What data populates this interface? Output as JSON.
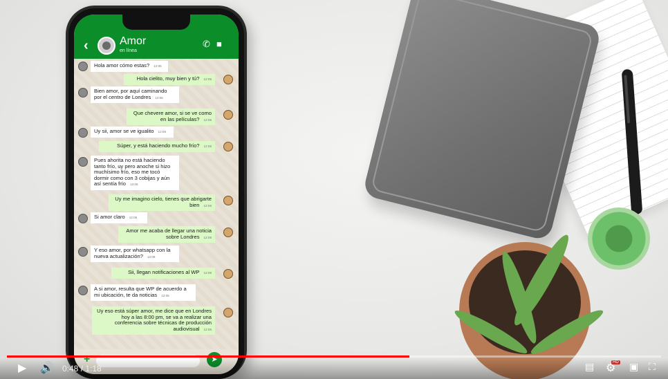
{
  "chat": {
    "contact_name": "Amor",
    "contact_status": "en línea",
    "messages": [
      {
        "dir": "in",
        "text": "Hola amor cómo estas?",
        "time": "12:05"
      },
      {
        "dir": "out",
        "text": "Hola cielito, muy bien y tú?",
        "time": "12:05"
      },
      {
        "dir": "in",
        "text": "Bien amor, por aquí caminando por el centro de Londres",
        "time": "12:05"
      },
      {
        "dir": "out",
        "text": "Que chevere amor, si se ve como en las películas?",
        "time": "12:05"
      },
      {
        "dir": "in",
        "text": "Uy sii, amor se ve igualito",
        "time": "12:06"
      },
      {
        "dir": "out",
        "text": "Súper, y está haciendo mucho frío?",
        "time": "12:06"
      },
      {
        "dir": "in",
        "text": "Pues ahorita no está haciendo tanto frío, uy pero anoche si hizo muchísimo frío, eso me tocó dormir como con 3 cobijas y aún así sentía frío",
        "time": "12:06"
      },
      {
        "dir": "out",
        "text": "Uy me imagino cielo, tienes que abrigarte bien",
        "time": "12:06"
      },
      {
        "dir": "in",
        "text": "Si amor claro",
        "time": "12:06"
      },
      {
        "dir": "out",
        "text": "Amor me acaba de llegar una noticia sobre Londres",
        "time": "12:06"
      },
      {
        "dir": "in",
        "text": "Y eso amor, por whatsapp con la nueva actualización?",
        "time": "12:06"
      },
      {
        "dir": "out",
        "text": "Sii, llegan notificaciones al WP",
        "time": "12:06"
      },
      {
        "dir": "in",
        "text": "A si amor, resulta que WP de acuerdo a mi ubicación, te da noticias",
        "time": "12:06"
      },
      {
        "dir": "out",
        "text": "Uy eso está súper amor, me dice que en Londres hoy a las 8:00 pm, se va a realizar una conferencia sobre técnicas de producción audiovisual",
        "time": "12:06"
      }
    ]
  },
  "player": {
    "current_time": "0:48",
    "duration": "1:18",
    "time_display": "0:48 / 1:18",
    "progress": 0.615,
    "hd_badge": "HD"
  },
  "icons": {
    "back": "chevron-left-icon",
    "call": "phone-icon",
    "video": "videocam-icon",
    "attach": "plus-icon",
    "send": "send-icon",
    "play": "play-icon",
    "volume": "volume-icon",
    "subtitles": "subtitles-icon",
    "settings": "gear-icon",
    "miniplayer": "miniplayer-icon",
    "fullscreen": "fullscreen-icon"
  },
  "colors": {
    "whatsapp_green": "#0b8e2a",
    "out_bubble": "#dcf8c6",
    "in_bubble": "#ffffff",
    "progress_red": "#ff0000"
  }
}
